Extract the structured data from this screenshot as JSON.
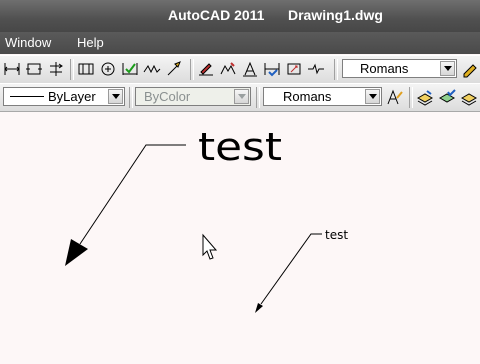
{
  "window": {
    "app_title": "AutoCAD 2011",
    "document_title": "Drawing1.dwg"
  },
  "menu": {
    "items": [
      "Window",
      "Help"
    ]
  },
  "toolbar_dim": {
    "buttons": [
      "linear-dim-icon",
      "aligned-dim-icon",
      "ordinate-dim-icon",
      "baseline-dim-icon",
      "continue-dim-icon",
      "center-mark-icon",
      "inspection-dim-icon",
      "jogged-linear-icon",
      "quick-leader-icon",
      "dim-edit-icon",
      "dim-text-edit-icon",
      "dim-update-icon",
      "dim-style-override-icon",
      "jog-line-icon"
    ],
    "text_style": "Romans"
  },
  "toolbar_props": {
    "linetype": "ByLayer",
    "color": "ByColor",
    "text_style": "Romans"
  },
  "drawing": {
    "leader_large_text": "test",
    "leader_small_text": "test"
  }
}
